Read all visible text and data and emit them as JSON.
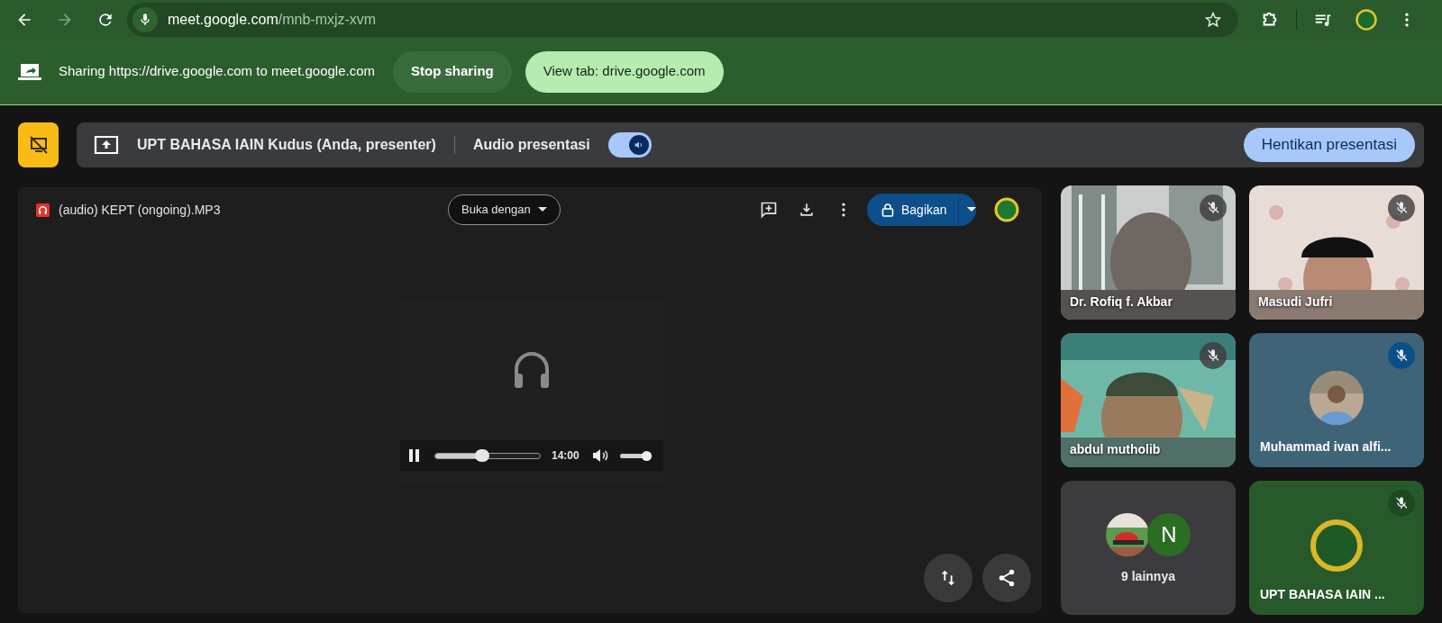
{
  "browser": {
    "url_host": "meet.google.com",
    "url_path": "/mnb-mxjz-xvm"
  },
  "sharing_bar": {
    "message": "Sharing https://drive.google.com to meet.google.com",
    "buttons": [
      {
        "label": "Stop sharing",
        "kind": "secondary"
      },
      {
        "label": "View tab: drive.google.com",
        "kind": "primary"
      }
    ]
  },
  "presentation_bar": {
    "presenter": "UPT BAHASA IAIN Kudus (Anda, presenter)",
    "audio_label": "Audio presentasi",
    "audio_on": true,
    "stop_button": "Hentikan presentasi"
  },
  "viewer": {
    "file_name": "(audio) KEPT (ongoing).MP3",
    "open_with": "Buka dengan",
    "share_button": "Bagikan",
    "player": {
      "playing": true,
      "progress": {
        "level": 0.45
      },
      "time": "14:00",
      "volume": {
        "level": 0.9
      }
    }
  },
  "tiles": [
    {
      "kind": "video",
      "name": "Dr. Rofiq f. Akbar",
      "muted": true
    },
    {
      "kind": "video",
      "name": "Masudi Jufri",
      "muted": true
    },
    {
      "kind": "video",
      "name": "abdul mutholib",
      "muted": true
    },
    {
      "kind": "avatar",
      "name": "Muhammad ivan alfi...",
      "muted": true
    },
    {
      "kind": "others",
      "label": "9 lainnya",
      "initial": "N"
    },
    {
      "kind": "self",
      "name": "UPT BAHASA IAIN ...",
      "muted": true
    }
  ]
}
